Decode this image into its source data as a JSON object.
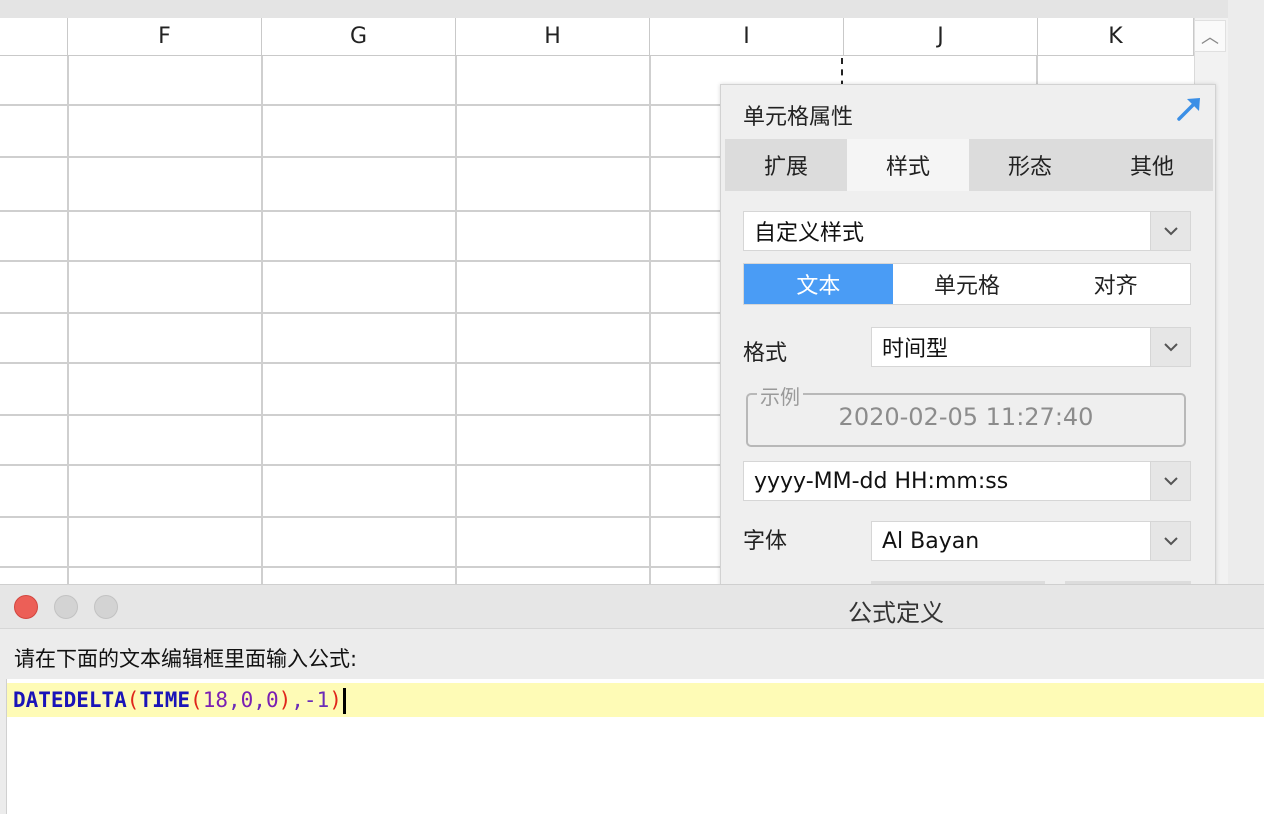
{
  "sheet": {
    "columns": [
      "F",
      "G",
      "H",
      "I",
      "J",
      "K"
    ],
    "scroll_up_glyph": "︿"
  },
  "panel": {
    "title": "单元格属性",
    "pin_icon": "expand-arrow-icon",
    "tabs": [
      "扩展",
      "样式",
      "形态",
      "其他"
    ],
    "active_tab": "样式",
    "style_select": "自定义样式",
    "segments": [
      "文本",
      "单元格",
      "对齐"
    ],
    "active_segment": "文本",
    "format_label": "格式",
    "format_value": "时间型",
    "example_label": "示例",
    "example_value": "2020-02-05 11:27:40",
    "pattern_value": "yyyy-MM-dd HH:mm:ss",
    "font_label": "字体",
    "font_value": "Al Bayan",
    "accent_color": "#4a9cf5"
  },
  "dialog": {
    "title": "公式定义",
    "prompt": "请在下面的文本编辑框里面输入公式:",
    "formula": {
      "fn1": "DATEDELTA",
      "open1": "(",
      "fn2": "TIME",
      "open2": "(",
      "a1": "18",
      "c1": ",",
      "a2": "0",
      "c2": ",",
      "a3": "0",
      "close2": ")",
      "c3": ",",
      "neg": "-1",
      "close1": ")"
    },
    "highlight_color": "#fefbb6"
  }
}
